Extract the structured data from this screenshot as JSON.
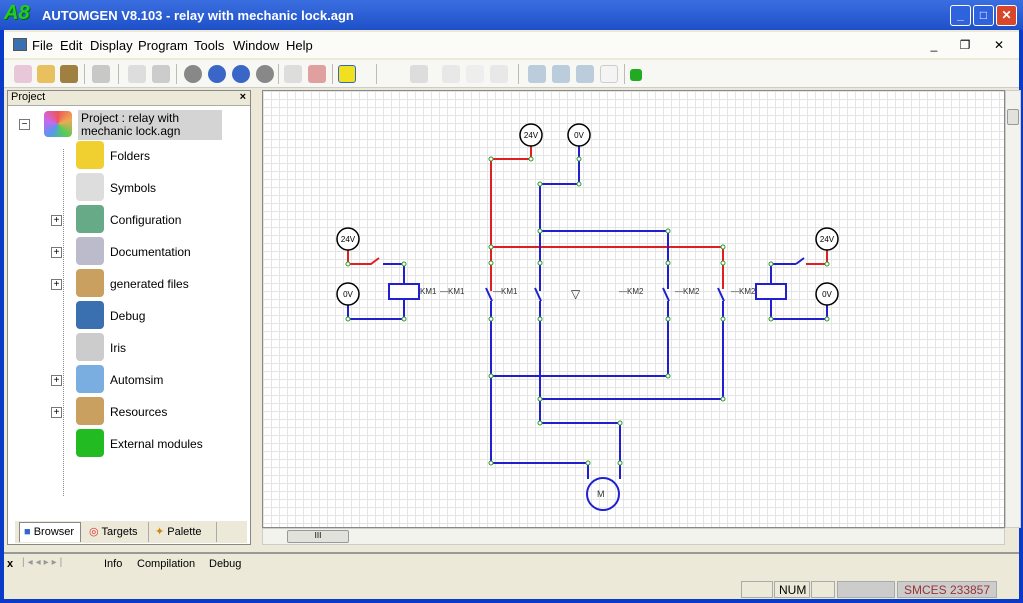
{
  "window": {
    "title": "AUTOMGEN V8.103 - relay with mechanic lock.agn",
    "logo": "A8"
  },
  "menu": [
    "File",
    "Edit",
    "Display",
    "Program",
    "Tools",
    "Window",
    "Help"
  ],
  "project_panel": {
    "title": "Project",
    "close": "×",
    "root": "Project : relay with mechanic lock.agn",
    "items": [
      {
        "label": "Folders",
        "icon": "folders-icon",
        "expandable": false
      },
      {
        "label": "Symbols",
        "icon": "symbols-tag-icon",
        "expandable": false
      },
      {
        "label": "Configuration",
        "icon": "tools-icon",
        "expandable": true
      },
      {
        "label": "Documentation",
        "icon": "printer-icon",
        "expandable": true
      },
      {
        "label": "generated files",
        "icon": "box-icon",
        "expandable": true
      },
      {
        "label": "Debug",
        "icon": "monitor-icon",
        "expandable": false
      },
      {
        "label": "Iris",
        "icon": "gauge-icon",
        "expandable": false
      },
      {
        "label": "Automsim",
        "icon": "gears-icon",
        "expandable": true
      },
      {
        "label": "Resources",
        "icon": "box-icon",
        "expandable": true
      },
      {
        "label": "External modules",
        "icon": "green-arrow-icon",
        "expandable": false
      }
    ],
    "tabs": [
      "Browser",
      "Targets",
      "Palette"
    ],
    "expand_symbol": "+",
    "collapse_symbol": "−"
  },
  "diagram": {
    "sources": {
      "plus": "24V",
      "zero": "0V"
    },
    "labels": {
      "km1": "KM1",
      "km1_contact": "—KM1",
      "km2": "KM2",
      "km2_contact": "—KM2",
      "triangle": "▽",
      "motor": "M"
    },
    "colors": {
      "live": "#e02020",
      "neutral": "#2020d0",
      "node": "#2a9a2a"
    }
  },
  "bottom_tabs": [
    "Info",
    "Compilation",
    "Debug"
  ],
  "status": {
    "num": "NUM",
    "license": "SMCES 233857"
  },
  "scroll_thumb": "III"
}
